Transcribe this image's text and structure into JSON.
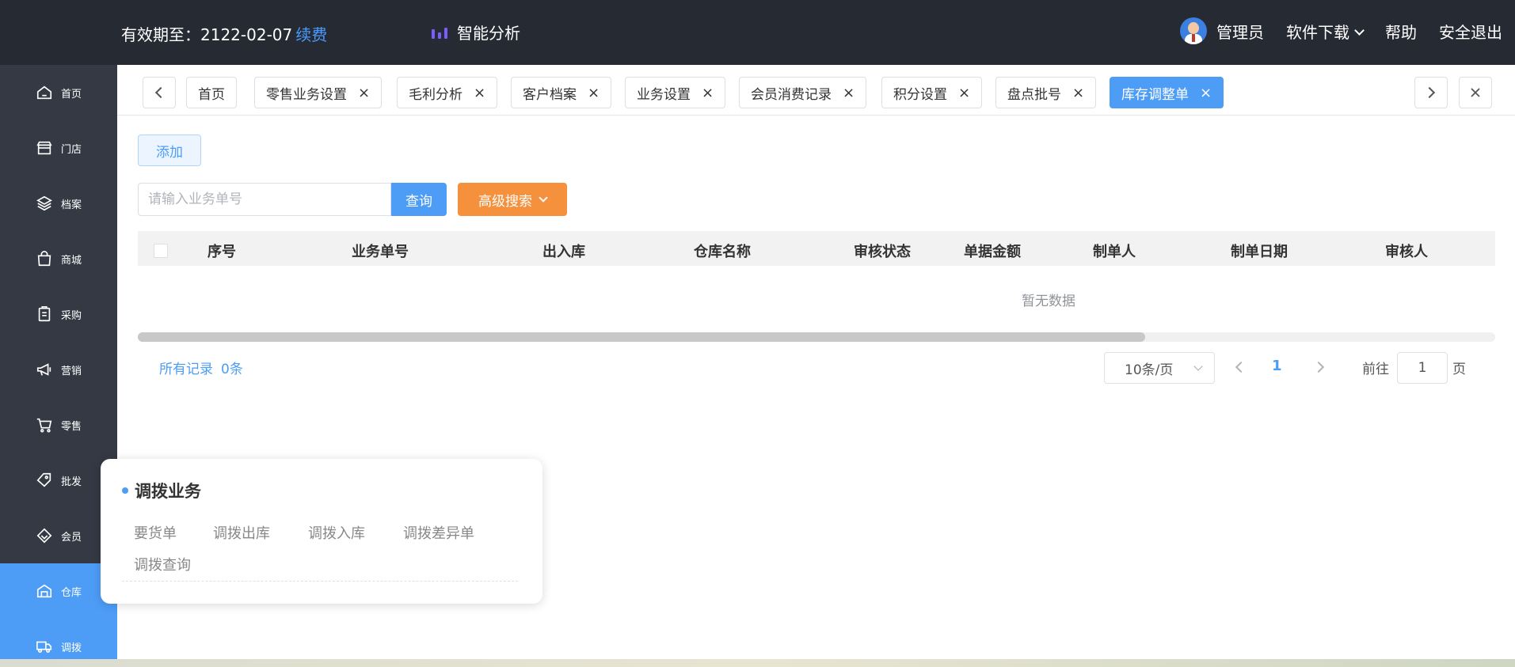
{
  "topbar": {
    "expire_label": "有效期至：2122-02-07",
    "renew": "续费",
    "analysis": "智能分析",
    "user": "管理员",
    "download": "软件下载",
    "help": "帮助",
    "logout": "安全退出"
  },
  "sidebar": {
    "items": [
      {
        "label": "首页",
        "icon": "home-icon"
      },
      {
        "label": "门店",
        "icon": "store-icon"
      },
      {
        "label": "档案",
        "icon": "layers-icon"
      },
      {
        "label": "商城",
        "icon": "bag-icon"
      },
      {
        "label": "采购",
        "icon": "clipboard-icon"
      },
      {
        "label": "营销",
        "icon": "megaphone-icon"
      },
      {
        "label": "零售",
        "icon": "cart-icon"
      },
      {
        "label": "批发",
        "icon": "tag-icon"
      },
      {
        "label": "会员",
        "icon": "diamond-icon"
      },
      {
        "label": "仓库",
        "icon": "warehouse-icon"
      },
      {
        "label": "调拨",
        "icon": "truck-icon"
      }
    ],
    "active_index": 9
  },
  "tabs": [
    {
      "label": "首页",
      "closable": false
    },
    {
      "label": "零售业务设置",
      "closable": true
    },
    {
      "label": "毛利分析",
      "closable": true
    },
    {
      "label": "客户档案",
      "closable": true
    },
    {
      "label": "业务设置",
      "closable": true
    },
    {
      "label": "会员消费记录",
      "closable": true
    },
    {
      "label": "积分设置",
      "closable": true
    },
    {
      "label": "盘点批号",
      "closable": true
    },
    {
      "label": "库存调整单",
      "closable": true,
      "active": true
    }
  ],
  "toolbar": {
    "add": "添加",
    "search_placeholder": "请输入业务单号",
    "query": "查询",
    "advanced": "高级搜索"
  },
  "table": {
    "columns": [
      "序号",
      "业务单号",
      "出入库",
      "仓库名称",
      "审核状态",
      "单据金额",
      "制单人",
      "制单日期",
      "审核人"
    ],
    "empty_text": "暂无数据"
  },
  "pagination": {
    "records_label": "所有记录",
    "records_count": "0条",
    "page_size": "10条/页",
    "current_page": "1",
    "goto_label": "前往",
    "goto_value": "1",
    "page_suffix": "页"
  },
  "popup": {
    "title": "调拨业务",
    "links": [
      "要货单",
      "调拨出库",
      "调拨入库",
      "调拨差异单",
      "调拨查询"
    ]
  },
  "colors": {
    "accent": "#4d9cf6",
    "topbar_bg": "#262a33",
    "sidebar_bg": "#343944",
    "advanced_btn": "#f5903d"
  }
}
